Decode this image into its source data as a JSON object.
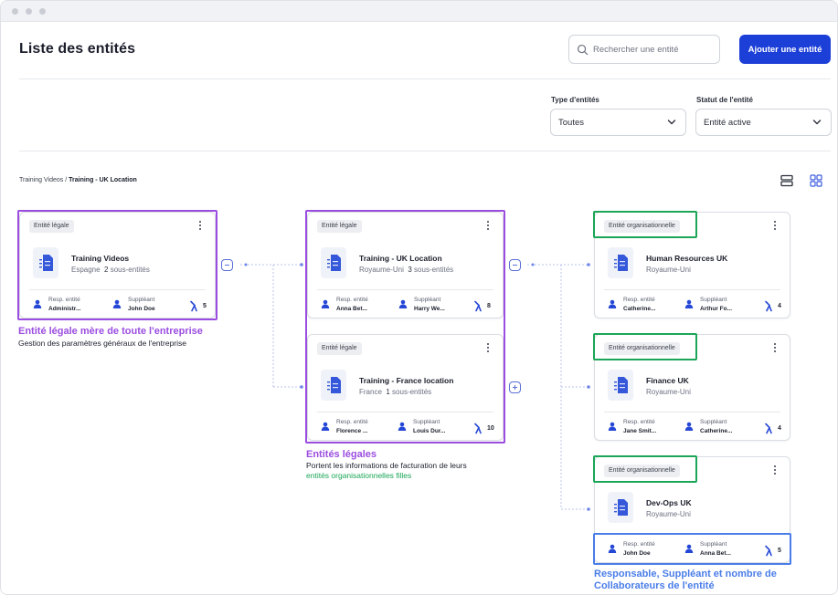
{
  "page": {
    "title": "Liste des entités",
    "search_placeholder": "Rechercher une entité",
    "add_button": "Ajouter une entité"
  },
  "filters": {
    "type": {
      "label": "Type d'entités",
      "value": "Toutes"
    },
    "status": {
      "label": "Statut de l'entité",
      "value": "Entité active"
    }
  },
  "breadcrumb": {
    "parent": "Training Videos",
    "separator": "/",
    "current": "Training - UK Location"
  },
  "colors": {
    "accent": "#1c3fd8",
    "purple": "#9b4de0",
    "green": "#1aa557",
    "blue": "#4a7de8"
  },
  "cards": [
    {
      "tag": "Entité légale",
      "name": "Training Videos",
      "country": "Espagne",
      "sub_count": "2",
      "sub_label": "sous-entités",
      "resp_label": "Resp. entité",
      "resp": "Administr...",
      "supp_label": "Suppléant",
      "supp": "John Doe",
      "count": "5"
    },
    {
      "tag": "Entité légale",
      "name": "Training - UK Location",
      "country": "Royaume-Uni",
      "sub_count": "3",
      "sub_label": "sous-entités",
      "resp_label": "Resp. entité",
      "resp": "Anna Bet...",
      "supp_label": "Suppléant",
      "supp": "Harry We...",
      "count": "8"
    },
    {
      "tag": "Entité légale",
      "name": "Training - France location",
      "country": "France",
      "sub_count": "1",
      "sub_label": "sous-entités",
      "resp_label": "Resp. entité",
      "resp": "Florence ...",
      "supp_label": "Suppléant",
      "supp": "Louis Dur...",
      "count": "10"
    },
    {
      "tag": "Entité organisationnelle",
      "name": "Human Resources UK",
      "country": "Royaume-Uni",
      "resp_label": "Resp. entité",
      "resp": "Catherine...",
      "supp_label": "Suppléant",
      "supp": "Arthur Fo...",
      "count": "4"
    },
    {
      "tag": "Entité organisationnelle",
      "name": "Finance UK",
      "country": "Royaume-Uni",
      "resp_label": "Resp. entité",
      "resp": "Jane Smit...",
      "supp_label": "Suppléant",
      "supp": "Catherine...",
      "count": "4"
    },
    {
      "tag": "Entité organisationnelle",
      "name": "Dev-Ops UK",
      "country": "Royaume-Uni",
      "resp_label": "Resp. entité",
      "resp": "John Doe",
      "supp_label": "Suppléant",
      "supp": "Anna Bet...",
      "count": "5"
    }
  ],
  "annotations": {
    "parent_title": "Entité légale mère de toute l'entreprise",
    "parent_text": "Gestion des paramètres généraux de l'entreprise",
    "legal_title": "Entités légales",
    "legal_text": "Portent les informations de facturation de leurs",
    "legal_text_green": "entités organisationnelles filles",
    "people_title_1": "Responsable, Suppléant et nombre de",
    "people_title_2": "Collaborateurs de l'entité"
  }
}
